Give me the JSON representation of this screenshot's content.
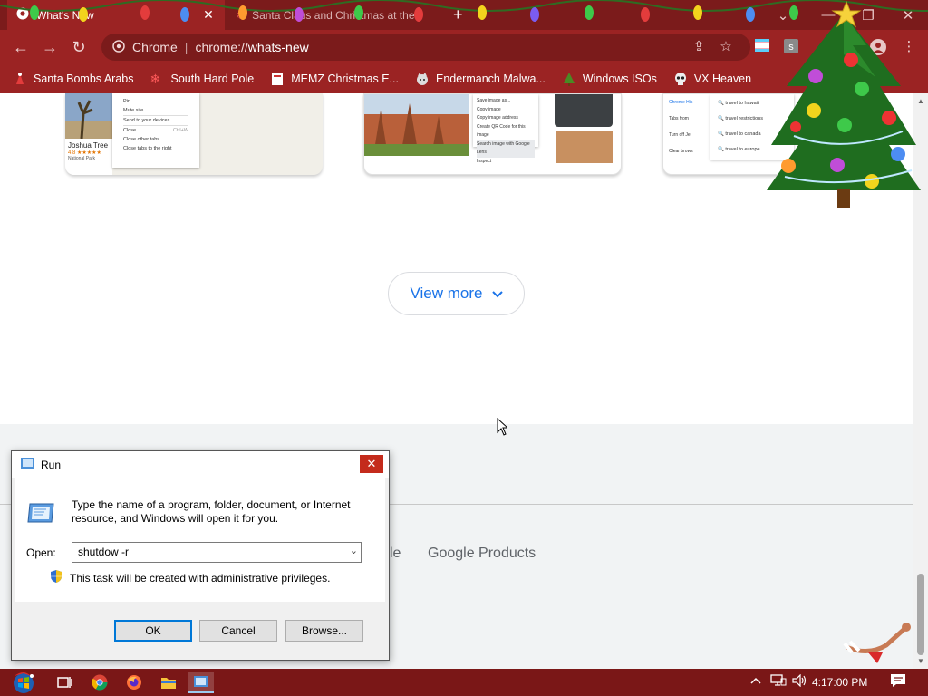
{
  "tabs": [
    {
      "title": "What's New",
      "active": true
    },
    {
      "title": "Santa Claus and Christmas at the",
      "active": false
    }
  ],
  "toolbar": {
    "omnibox_site": "Chrome",
    "omnibox_scheme": "chrome://",
    "omnibox_path": "whats-new"
  },
  "bookmarks": [
    {
      "label": "Santa Bombs Arabs",
      "icon": "santa-icon"
    },
    {
      "label": "South Hard Pole",
      "icon": "snowflake-icon"
    },
    {
      "label": "MEMZ Christmas E...",
      "icon": "page-icon"
    },
    {
      "label": "Endermanch Malwa...",
      "icon": "cat-icon"
    },
    {
      "label": "Windows ISOs",
      "icon": "tree-icon"
    },
    {
      "label": "VX Heaven",
      "icon": "skull-icon"
    }
  ],
  "page": {
    "card1": {
      "name": "Joshua Tree",
      "rating": "4.8",
      "subtitle": "National Park",
      "menu": [
        "Pin",
        "Mute site",
        "Send to your devices",
        "Close",
        "Close other tabs",
        "Close tabs to the right"
      ],
      "shortcut": "Ctrl+W"
    },
    "card2": {
      "menu": [
        "Save image as...",
        "Copy image",
        "Copy image address",
        "Create QR Code for this image",
        "Search image with Google Lens",
        "Inspect"
      ]
    },
    "card3": {
      "suggestions": [
        "travel to hawaii",
        "travel restrictions",
        "travel to canada",
        "travel to europe"
      ],
      "items": [
        "Chrome His",
        "Tabs from",
        "Turn off Je",
        "Clear brows"
      ]
    },
    "view_more": "View more",
    "footer_partial": "le",
    "footer_link": "Google Products"
  },
  "run_dialog": {
    "title": "Run",
    "description": "Type the name of a program, folder, document, or Internet resource, and Windows will open it for you.",
    "open_label": "Open:",
    "input_value": "shutdow -r",
    "admin_note": "This task will be created with administrative privileges.",
    "ok": "OK",
    "cancel": "Cancel",
    "browse": "Browse..."
  },
  "taskbar": {
    "clock": "4:17:00 PM"
  },
  "colors": {
    "frame_dark": "#7b1b1b",
    "frame": "#9b2323",
    "link_blue": "#1a73e8",
    "close_red": "#c42b1c"
  }
}
